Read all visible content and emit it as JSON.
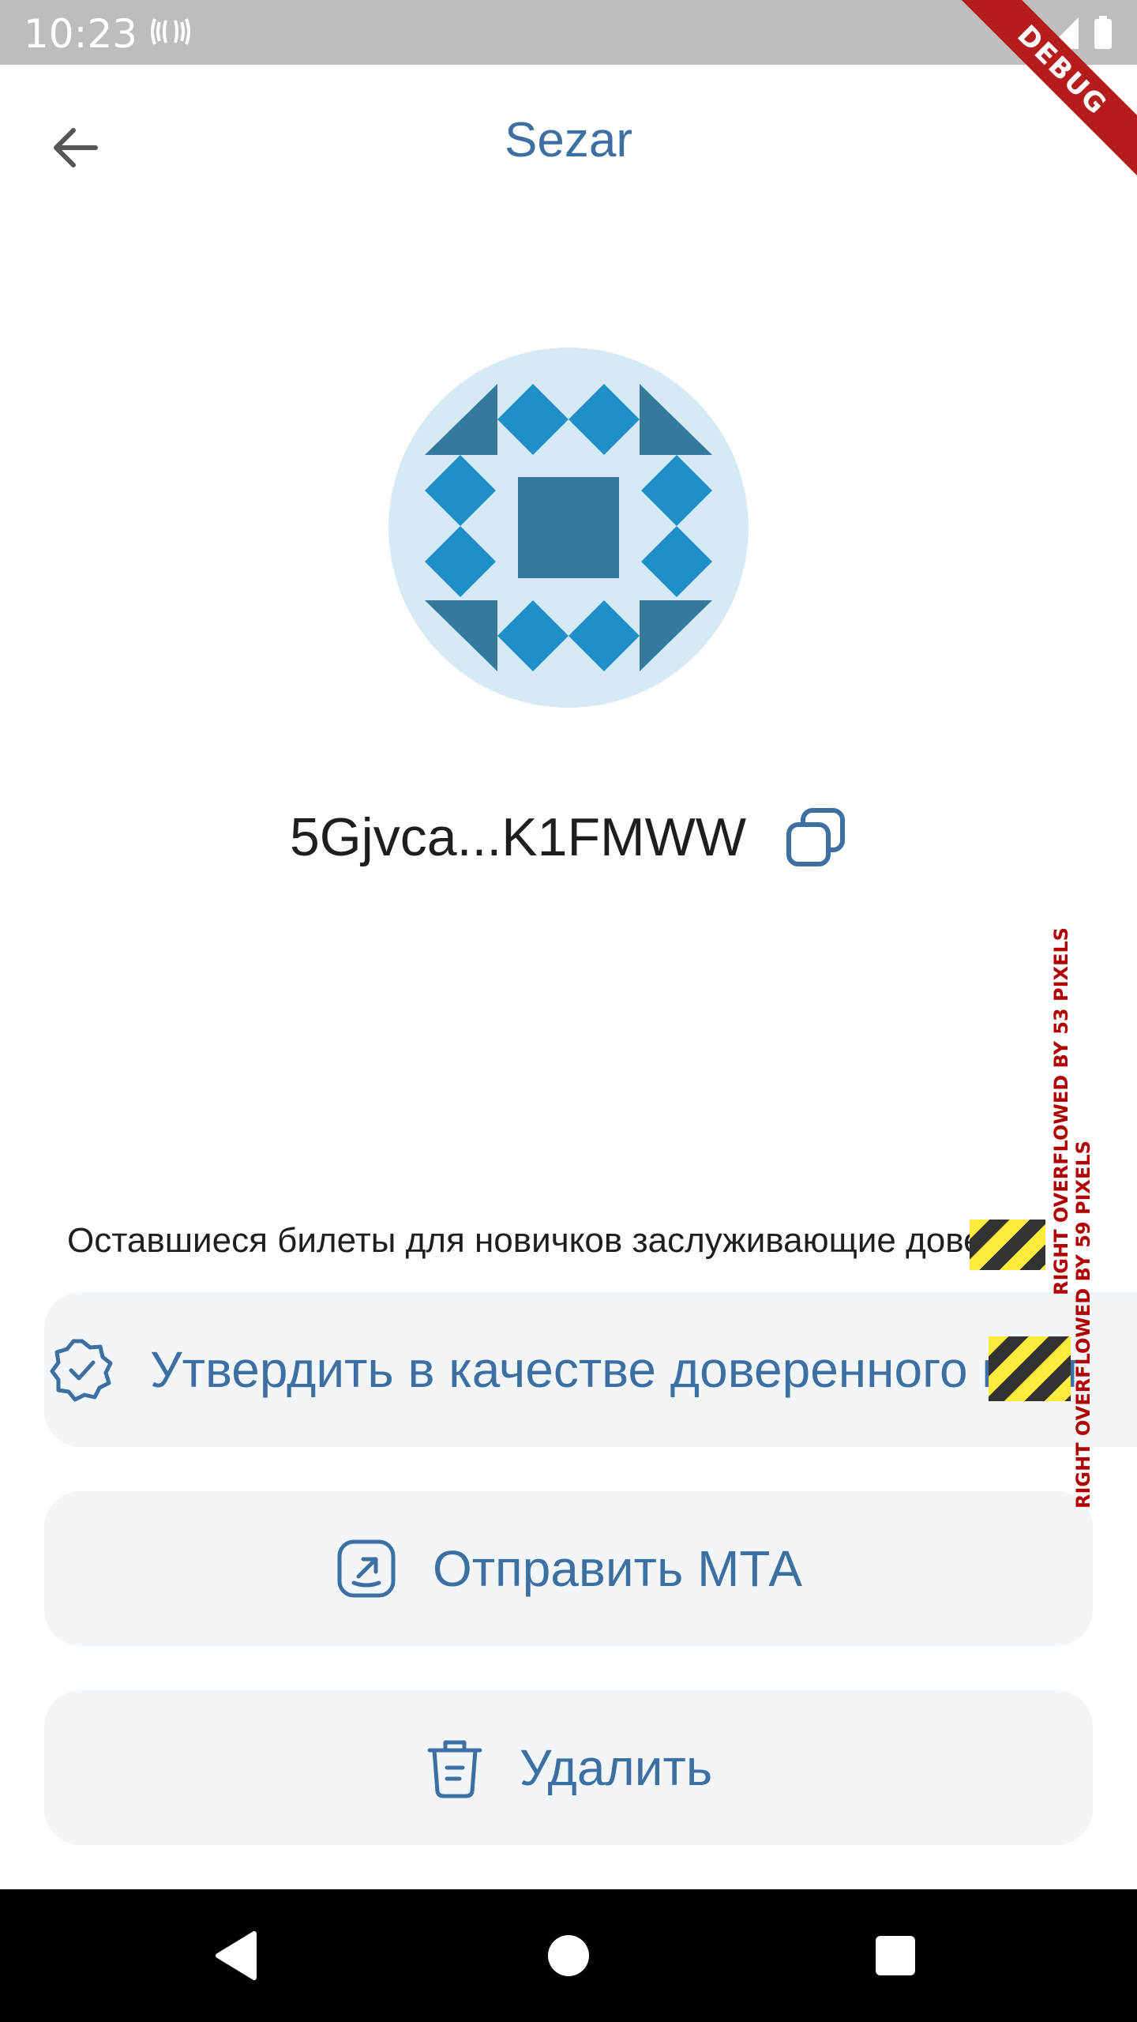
{
  "status_bar": {
    "time": "10:23",
    "icons": [
      "vibration-icon",
      "wifi-icon",
      "signal-icon",
      "battery-icon"
    ]
  },
  "debug_banner": "DEBUG",
  "app_bar": {
    "title": "Sezar",
    "back_icon": "arrow-left-icon"
  },
  "avatar": {
    "icon": "identicon",
    "colors": {
      "bg": "#d6eaf6",
      "dark": "#357a9c",
      "light": "#1e8fc8"
    }
  },
  "address": {
    "text": "5Gjvca...K1FMWW",
    "copy_icon": "copy-icon"
  },
  "info": {
    "text": "Оставшиеся билеты для новичков заслуживающие довери"
  },
  "actions": {
    "trust": {
      "label": "Утвердить в качестве доверенного конт",
      "icon": "verified-badge-icon"
    },
    "send": {
      "label": "Отправить МТА",
      "icon": "send-arrow-icon"
    },
    "delete": {
      "label": "Удалить",
      "icon": "trash-icon"
    }
  },
  "overflow_warnings": {
    "first": "RIGHT OVERFLOWED BY 53 PIXELS",
    "second": "RIGHT OVERFLOWED BY 59 PIXELS"
  },
  "colors": {
    "accent": "#3d6fa2",
    "button_bg": "#f3f6f8",
    "status_bar": "#bdbdbd"
  }
}
